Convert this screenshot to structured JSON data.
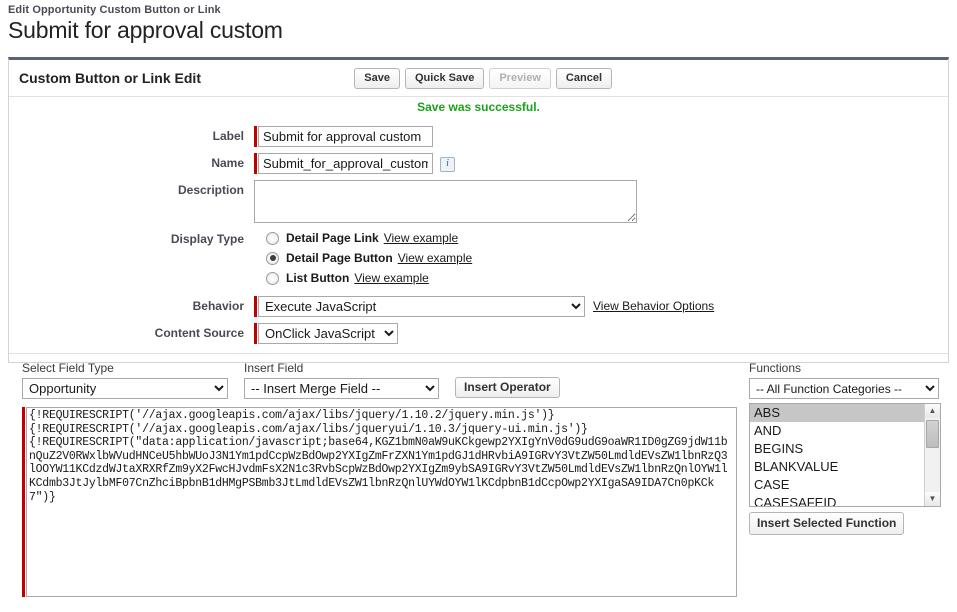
{
  "page": {
    "breadcrumb": "Edit Opportunity Custom Button or Link",
    "title": "Submit for approval custom"
  },
  "panel": {
    "title": "Custom Button or Link Edit",
    "buttons": {
      "save": "Save",
      "quick_save": "Quick Save",
      "preview": "Preview",
      "cancel": "Cancel"
    },
    "status_message": "Save was successful.",
    "status_color": "#19a319"
  },
  "form": {
    "label_field": {
      "label": "Label",
      "value": "Submit for approval custom"
    },
    "name_field": {
      "label": "Name",
      "value": "Submit_for_approval_custom",
      "info_glyph": "i"
    },
    "description_field": {
      "label": "Description",
      "value": ""
    },
    "display_type": {
      "label": "Display Type",
      "options": [
        {
          "label": "Detail Page Link",
          "link": "View example",
          "selected": false
        },
        {
          "label": "Detail Page Button",
          "link": "View example",
          "selected": true
        },
        {
          "label": "List Button",
          "link": "View example",
          "selected": false
        }
      ]
    },
    "behavior": {
      "label": "Behavior",
      "value": "Execute JavaScript",
      "link": "View Behavior Options"
    },
    "content_source": {
      "label": "Content Source",
      "value": "OnClick JavaScript"
    }
  },
  "editor": {
    "field_type": {
      "label": "Select Field Type",
      "value": "Opportunity"
    },
    "insert_field": {
      "label": "Insert Field",
      "value": "-- Insert Merge Field --"
    },
    "insert_operator_label": "Insert Operator",
    "functions": {
      "label": "Functions",
      "category_value": "-- All Function Categories --",
      "items": [
        {
          "name": "ABS",
          "selected": true
        },
        {
          "name": "AND",
          "selected": false
        },
        {
          "name": "BEGINS",
          "selected": false
        },
        {
          "name": "BLANKVALUE",
          "selected": false
        },
        {
          "name": "CASE",
          "selected": false
        },
        {
          "name": "CASESAFEID",
          "selected": false
        }
      ],
      "insert_button": "Insert Selected Function"
    },
    "code": "{!REQUIRESCRIPT('//ajax.googleapis.com/ajax/libs/jquery/1.10.2/jquery.min.js')}\n{!REQUIRESCRIPT('//ajax.googleapis.com/ajax/libs/jqueryui/1.10.3/jquery-ui.min.js')}\n{!REQUIRESCRIPT(\"data:application/javascript;base64,KGZ1bmN0aW9uKCkgewp2YXIgYnV0dG9udG9oaWR1ID0gZG9jdW11bnQuZ2V0RWxlbWVudHNCeU5hbWUoJ3N1Ym1pdCcpWzBdOwp2YXIgZmFrZXN1Ym1pdGJ1dHRvbiA9IGRvY3VtZW50LmdldEVsZW1lbnRzQ3lOOYW11KCdzdWJtaXRXRfZm9yX2FwcHJvdmFsX2N1c3RvbScpWzBdOwp2YXIgZm9ybSA9IGRvY3VtZW50LmdldEVsZW1lbnRzQnlOYW1lKCdmb3JtJylbMF07CnZhciBpbnB1dHMgPSBmb3JtLmdldEVsZW1lbnRzQnlUYWdOYW1lKCdpbnB1dCcpOwp2YXIgaSA9IDA7Cn0pKCk7\")}"
  }
}
